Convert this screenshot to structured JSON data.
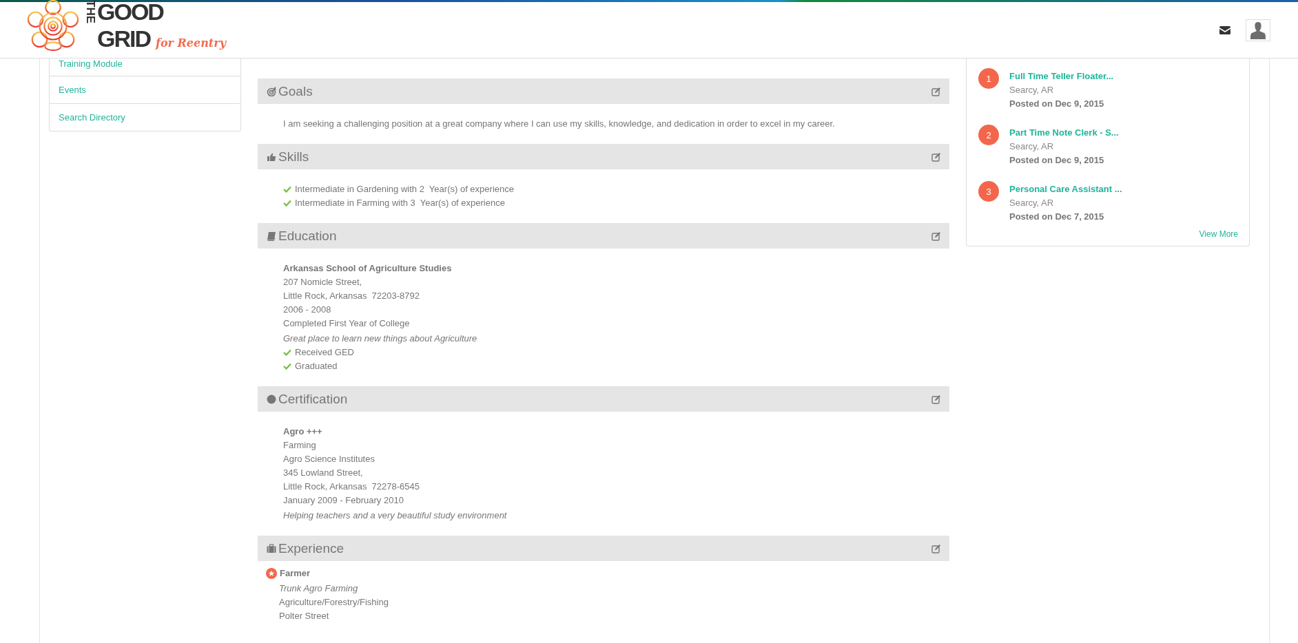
{
  "header": {
    "logo": {
      "word_top": "THE",
      "word_1": "GOOD",
      "word_2": "GRID",
      "tagline": "for Reentry"
    }
  },
  "sidebar": {
    "items": [
      {
        "label": "Training Module"
      },
      {
        "label": "Events"
      },
      {
        "label": "Search Directory"
      }
    ]
  },
  "sections": [
    {
      "kind": "goals",
      "title": "Goals",
      "text": "I am seeking a challenging position at a great company where I can use my skills, knowledge, and dedication in order to excel in my career."
    },
    {
      "kind": "skills",
      "title": "Skills",
      "items": [
        "Intermediate in Gardening with 2  Year(s) of experience",
        "Intermediate in Farming with 3  Year(s) of experience"
      ]
    },
    {
      "kind": "education",
      "title": "Education",
      "name": "Arkansas School of Agriculture Studies",
      "lines": [
        "207 Nomicle Street,",
        "Little Rock, Arkansas  72203-8792",
        "2006 - 2008",
        "Completed First Year of College"
      ],
      "note": "Great place to learn new things about Agriculture",
      "checks": [
        "Received GED",
        "Graduated"
      ]
    },
    {
      "kind": "certification",
      "title": "Certification",
      "name": "Agro +++",
      "lines": [
        "Farming",
        "Agro Science Institutes",
        "345 Lowland Street,",
        "Little Rock, Arkansas  72278-6545",
        "January 2009 - February 2010"
      ],
      "note": "Helping teachers and a very beautiful study environment"
    },
    {
      "kind": "experience",
      "title": "Experience",
      "name": "Farmer",
      "company": "Trunk Agro Farming",
      "lines": [
        "Agriculture/Forestry/Fishing",
        "Polter Street"
      ]
    }
  ],
  "jobs": {
    "items": [
      {
        "number": "1",
        "title": "Full Time Teller Floater...",
        "location": "Searcy, AR",
        "posted": "Posted on Dec 9, 2015"
      },
      {
        "number": "2",
        "title": "Part Time Note Clerk - S...",
        "location": "Searcy, AR",
        "posted": "Posted on Dec 9, 2015"
      },
      {
        "number": "3",
        "title": "Personal Care Assistant ...",
        "location": "Searcy, AR",
        "posted": "Posted on Dec 7, 2015"
      }
    ],
    "view_more": "View More"
  }
}
